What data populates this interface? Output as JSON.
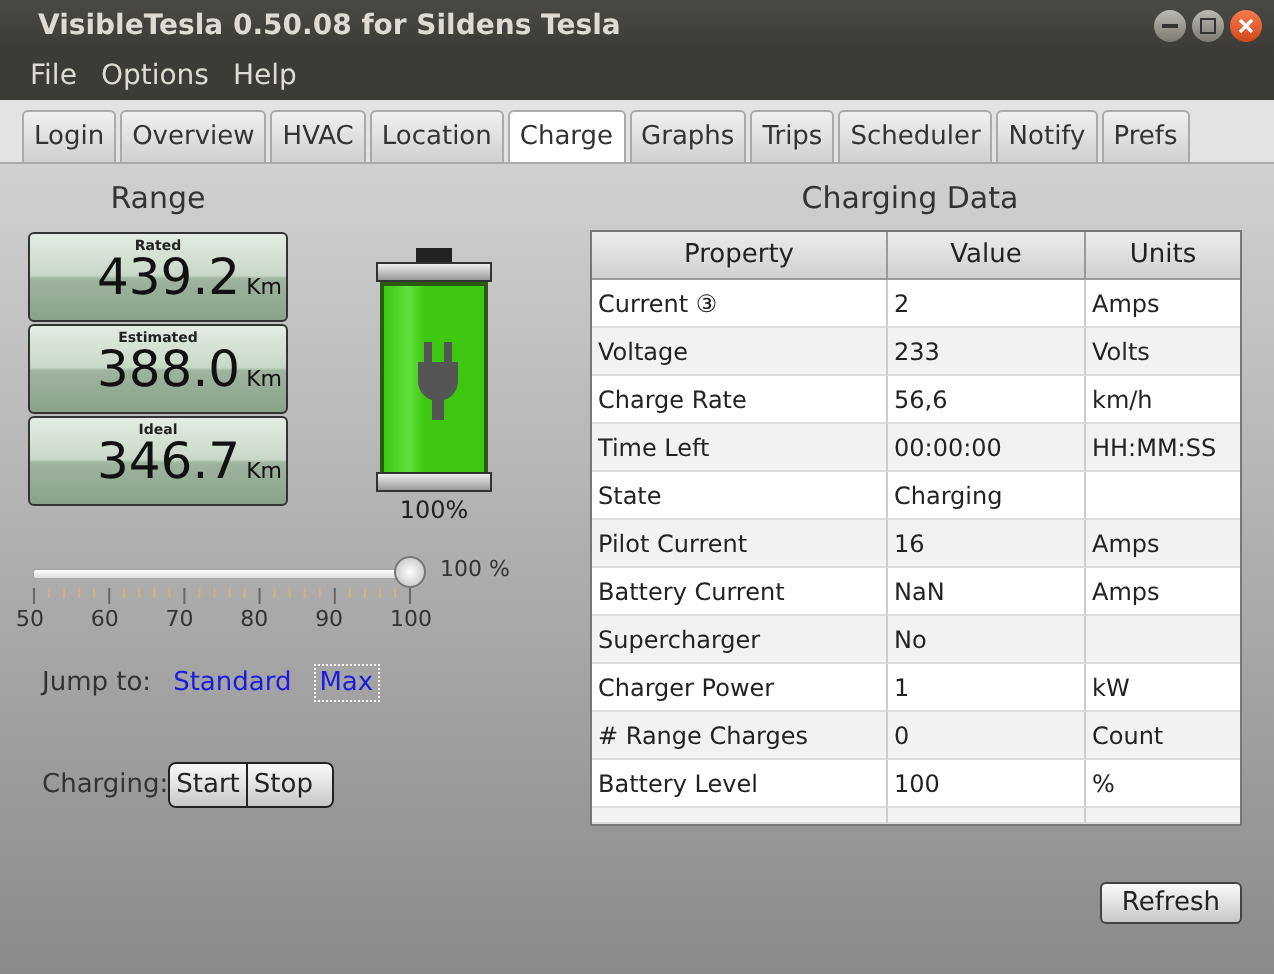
{
  "window": {
    "title": "VisibleTesla 0.50.08 for Sildens Tesla"
  },
  "menu": [
    "File",
    "Options",
    "Help"
  ],
  "tabs": [
    {
      "label": "Login",
      "selected": false
    },
    {
      "label": "Overview",
      "selected": false
    },
    {
      "label": "HVAC",
      "selected": false
    },
    {
      "label": "Location",
      "selected": false
    },
    {
      "label": "Charge",
      "selected": true
    },
    {
      "label": "Graphs",
      "selected": false
    },
    {
      "label": "Trips",
      "selected": false
    },
    {
      "label": "Scheduler",
      "selected": false
    },
    {
      "label": "Notify",
      "selected": false
    },
    {
      "label": "Prefs",
      "selected": false
    }
  ],
  "range": {
    "title": "Range",
    "gauges": [
      {
        "label": "Rated",
        "value": "439.2",
        "unit": "Km"
      },
      {
        "label": "Estimated",
        "value": "388.0",
        "unit": "Km"
      },
      {
        "label": "Ideal",
        "value": "346.7",
        "unit": "Km"
      }
    ]
  },
  "battery": {
    "level": 1,
    "reading": "100%"
  },
  "charge_limit": {
    "level": 1,
    "reading": "100 %",
    "ticks": [
      "50",
      "60",
      "70",
      "80",
      "90",
      "100"
    ]
  },
  "jump_to": {
    "label": "Jump to:",
    "links": [
      {
        "label": "Standard",
        "focused": false
      },
      {
        "label": "Max",
        "focused": true
      }
    ]
  },
  "charging": {
    "label": "Charging:",
    "buttons": [
      "Start",
      "Stop"
    ]
  },
  "charging_data": {
    "title": "Charging Data",
    "columns": [
      "Property",
      "Value",
      "Units"
    ],
    "rows": [
      [
        "Current ③",
        "2",
        "Amps"
      ],
      [
        "Voltage",
        "233",
        "Volts"
      ],
      [
        "Charge Rate",
        "56,6",
        "km/h"
      ],
      [
        "Time Left",
        "00:00:00",
        "HH:MM:SS"
      ],
      [
        "State",
        "Charging",
        ""
      ],
      [
        "Pilot Current",
        "16",
        "Amps"
      ],
      [
        "Battery Current",
        "NaN",
        "Amps"
      ],
      [
        "Supercharger",
        "No",
        ""
      ],
      [
        "Charger Power",
        "1",
        "kW"
      ],
      [
        "# Range Charges",
        "0",
        "Count"
      ],
      [
        "Battery Level",
        "100",
        "%"
      ]
    ]
  },
  "refresh_button": "Refresh"
}
